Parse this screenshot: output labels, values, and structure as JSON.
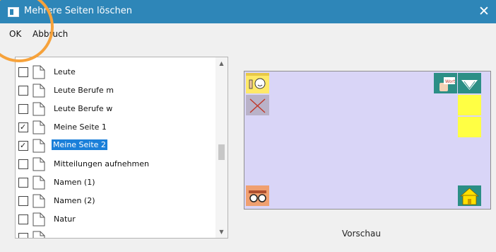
{
  "window": {
    "title": "Mehrere Seiten löschen",
    "close_glyph": "✕"
  },
  "menu": {
    "ok_label": "OK",
    "cancel_label": "Abbruch"
  },
  "list": {
    "items": [
      {
        "label": "Leute",
        "checked": false,
        "selected": false
      },
      {
        "label": "Leute Berufe m",
        "checked": false,
        "selected": false
      },
      {
        "label": "Leute Berufe w",
        "checked": false,
        "selected": false
      },
      {
        "label": "Meine Seite 1",
        "checked": true,
        "selected": false
      },
      {
        "label": "Meine Seite 2",
        "checked": true,
        "selected": true
      },
      {
        "label": "Mitteilungen aufnehmen",
        "checked": false,
        "selected": false
      },
      {
        "label": "Namen (1)",
        "checked": false,
        "selected": false
      },
      {
        "label": "Namen (2)",
        "checked": false,
        "selected": false
      },
      {
        "label": "Natur",
        "checked": false,
        "selected": false
      },
      {
        "label": "",
        "checked": false,
        "selected": false
      }
    ],
    "check_glyph": "✓",
    "scroll_up_glyph": "▲",
    "scroll_down_glyph": "▼"
  },
  "preview": {
    "label": "Vorschau",
    "background_color": "#d9d5f7",
    "symbol_text": "Wort"
  },
  "colors": {
    "titlebar": "#2e86b8",
    "selection": "#1a7fd9",
    "highlight_ring": "#f6a23b"
  }
}
